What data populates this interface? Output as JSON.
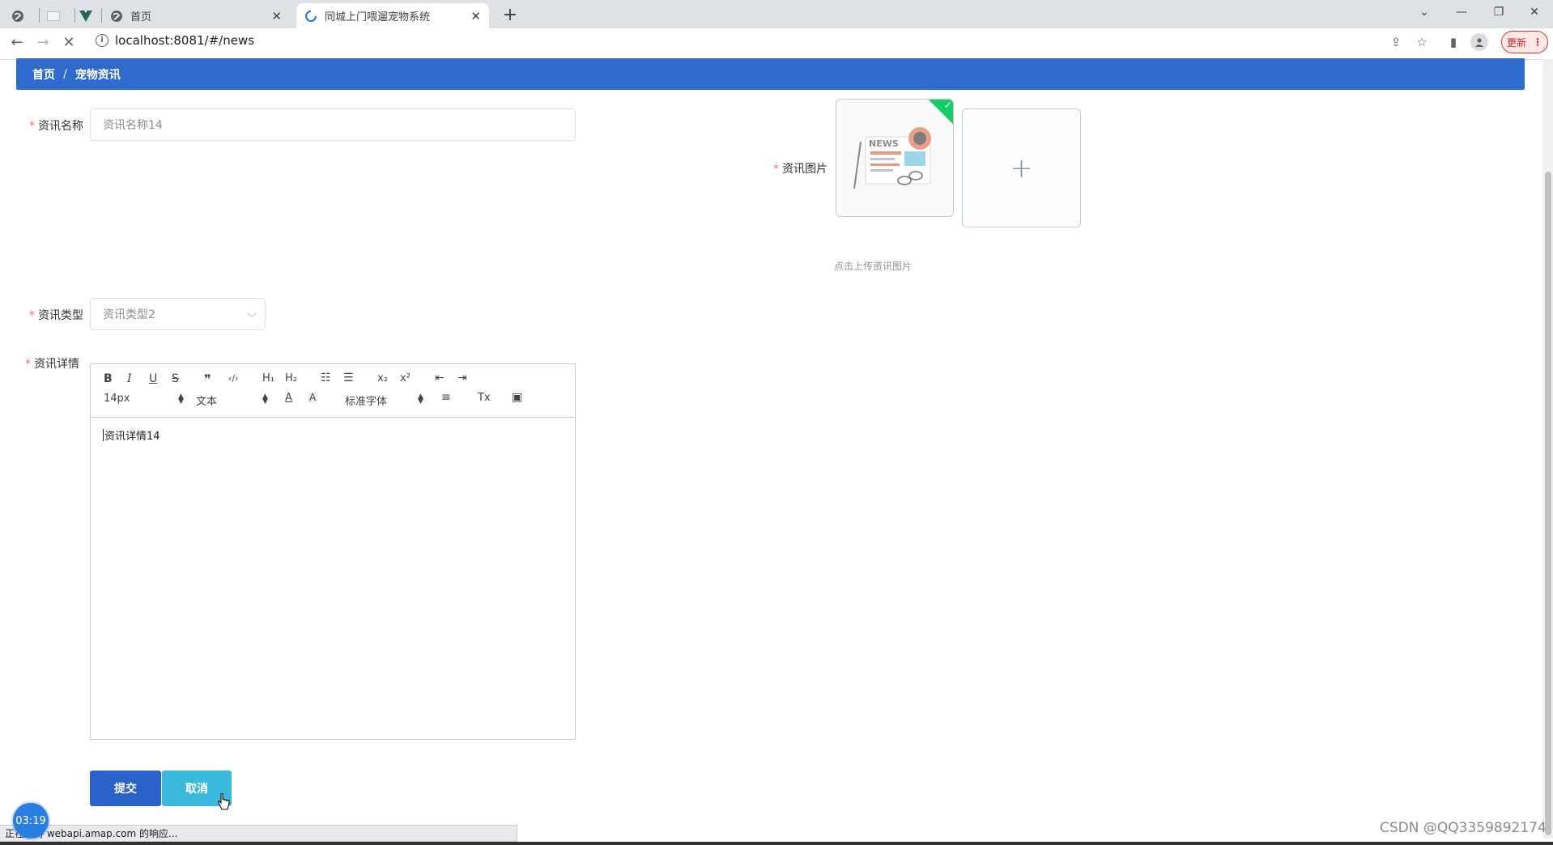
{
  "browser": {
    "tabs": [
      {
        "title": "",
        "icon": "globe-icon"
      },
      {
        "title": "",
        "icon": "blank-page-icon"
      },
      {
        "title": "",
        "icon": "vue-logo-icon"
      },
      {
        "title": "首页",
        "icon": "globe-icon"
      },
      {
        "title": "同城上门喂遛宠物系统",
        "icon": "loading-icon",
        "active": true
      }
    ],
    "url": "localhost:8081/#/news",
    "update_button": "更新",
    "status_text": "正在等待 webapi.amap.com 的响应..."
  },
  "breadcrumb": {
    "home": "首页",
    "separator": "/",
    "current": "宠物资讯"
  },
  "form": {
    "name_label": "资讯名称",
    "name_value": "资讯名称14",
    "image_label": "资讯图片",
    "image_thumb_text": "NEWS",
    "upload_tip": "点击上传资讯图片",
    "type_label": "资讯类型",
    "type_value": "资讯类型2",
    "detail_label": "资讯详情",
    "required_mark": "*"
  },
  "editor": {
    "buttons": {
      "bold": "B",
      "italic": "I",
      "underline": "U",
      "strike": "S",
      "blockquote": "❞",
      "code": "‹/›",
      "h1": "H₁",
      "h2": "H₂",
      "ordered_list": "☷",
      "bullet_list": "☰",
      "subscript": "x₂",
      "superscript": "x²",
      "outdent": "⇤",
      "indent": "⇥",
      "align": "≡",
      "clean": "Tx",
      "image": "▣"
    },
    "size_select": "14px",
    "header_select": "文本",
    "font_select": "标准字体",
    "content": "资讯详情14"
  },
  "actions": {
    "submit": "提交",
    "cancel": "取消"
  },
  "overlay": {
    "timer": "03:19",
    "watermark": "CSDN @QQ3359892174"
  },
  "colors": {
    "breadcrumb_bg": "#2f6bcd",
    "submit_bg": "#2a62c9",
    "cancel_bg": "#3ab9dd",
    "required": "#f56c6c",
    "upload_success": "#13ce66"
  }
}
